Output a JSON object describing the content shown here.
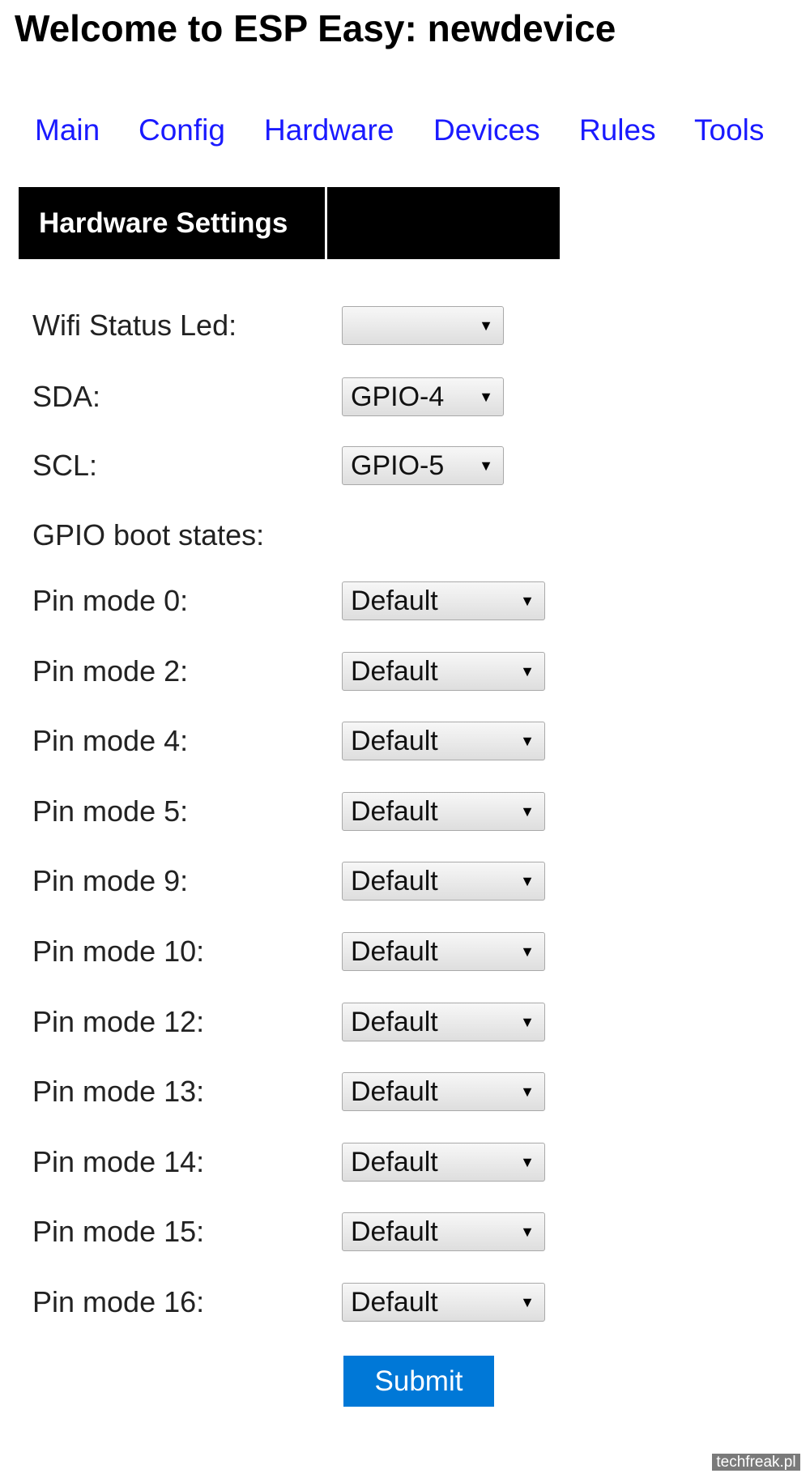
{
  "title": "Welcome to ESP Easy: newdevice",
  "nav": [
    "Main",
    "Config",
    "Hardware",
    "Devices",
    "Rules",
    "Tools"
  ],
  "header": {
    "left": "Hardware Settings",
    "right": ""
  },
  "fields": [
    {
      "label": "Wifi Status Led:",
      "value": ""
    },
    {
      "label": "SDA:",
      "value": "GPIO-4"
    },
    {
      "label": "SCL:",
      "value": "GPIO-5"
    }
  ],
  "boot_states_label": "GPIO boot states:",
  "pins": [
    {
      "label": "Pin mode 0:",
      "value": "Default"
    },
    {
      "label": "Pin mode 2:",
      "value": "Default"
    },
    {
      "label": "Pin mode 4:",
      "value": "Default"
    },
    {
      "label": "Pin mode 5:",
      "value": "Default"
    },
    {
      "label": "Pin mode 9:",
      "value": "Default"
    },
    {
      "label": "Pin mode 10:",
      "value": "Default"
    },
    {
      "label": "Pin mode 12:",
      "value": "Default"
    },
    {
      "label": "Pin mode 13:",
      "value": "Default"
    },
    {
      "label": "Pin mode 14:",
      "value": "Default"
    },
    {
      "label": "Pin mode 15:",
      "value": "Default"
    },
    {
      "label": "Pin mode 16:",
      "value": "Default"
    }
  ],
  "submit_label": "Submit",
  "dropdown_arrow": "▼",
  "watermark": "techfreak.pl",
  "colors": {
    "link": "#1a1aff",
    "submit": "#0078d7",
    "header_bg": "#000000"
  }
}
